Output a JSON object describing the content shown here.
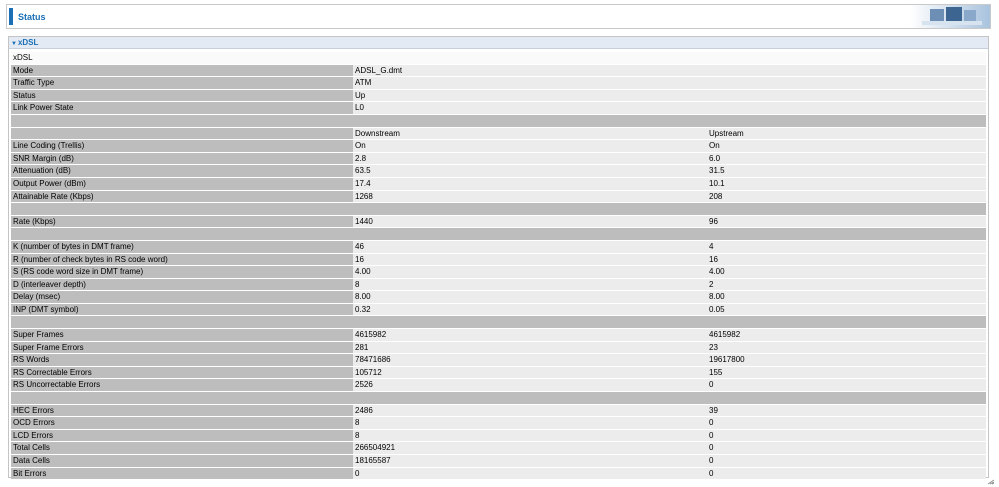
{
  "header": {
    "title": "Status"
  },
  "panel": {
    "title": "xDSL"
  },
  "table": {
    "section_label": "xDSL",
    "columns": {
      "downstream": "Downstream",
      "upstream": "Upstream"
    },
    "info": [
      {
        "label": "Mode",
        "value": "ADSL_G.dmt"
      },
      {
        "label": "Traffic Type",
        "value": "ATM"
      },
      {
        "label": "Status",
        "value": "Up"
      },
      {
        "label": "Link Power State",
        "value": "L0"
      }
    ],
    "groups": [
      [
        {
          "label": "Line Coding (Trellis)",
          "down": "On",
          "up": "On"
        },
        {
          "label": "SNR Margin (dB)",
          "down": "2.8",
          "up": "6.0"
        },
        {
          "label": "Attenuation (dB)",
          "down": "63.5",
          "up": "31.5"
        },
        {
          "label": "Output Power (dBm)",
          "down": "17.4",
          "up": "10.1"
        },
        {
          "label": "Attainable Rate (Kbps)",
          "down": "1268",
          "up": "208"
        }
      ],
      [
        {
          "label": "Rate (Kbps)",
          "down": "1440",
          "up": "96"
        }
      ],
      [
        {
          "label": "K (number of bytes in DMT frame)",
          "down": "46",
          "up": "4"
        },
        {
          "label": "R (number of check bytes in RS code word)",
          "down": "16",
          "up": "16"
        },
        {
          "label": "S (RS code word size in DMT frame)",
          "down": "4.00",
          "up": "4.00"
        },
        {
          "label": "D (interleaver depth)",
          "down": "8",
          "up": "2"
        },
        {
          "label": "Delay (msec)",
          "down": "8.00",
          "up": "8.00"
        },
        {
          "label": "INP (DMT symbol)",
          "down": "0.32",
          "up": "0.05"
        }
      ],
      [
        {
          "label": "Super Frames",
          "down": "4615982",
          "up": "4615982"
        },
        {
          "label": "Super Frame Errors",
          "down": "281",
          "up": "23"
        },
        {
          "label": "RS Words",
          "down": "78471686",
          "up": "19617800"
        },
        {
          "label": "RS Correctable Errors",
          "down": "105712",
          "up": "155"
        },
        {
          "label": "RS Uncorrectable Errors",
          "down": "2526",
          "up": "0"
        }
      ],
      [
        {
          "label": "HEC Errors",
          "down": "2486",
          "up": "39"
        },
        {
          "label": "OCD Errors",
          "down": "8",
          "up": "0"
        },
        {
          "label": "LCD Errors",
          "down": "8",
          "up": "0"
        },
        {
          "label": "Total Cells",
          "down": "266504921",
          "up": "0"
        },
        {
          "label": "Data Cells",
          "down": "18165587",
          "up": "0"
        },
        {
          "label": "Bit Errors",
          "down": "0",
          "up": "0"
        }
      ]
    ]
  },
  "colors": {
    "accent": "#1a6fb5",
    "label_bg": "#bdbdbd",
    "value_bg": "#ececec"
  }
}
